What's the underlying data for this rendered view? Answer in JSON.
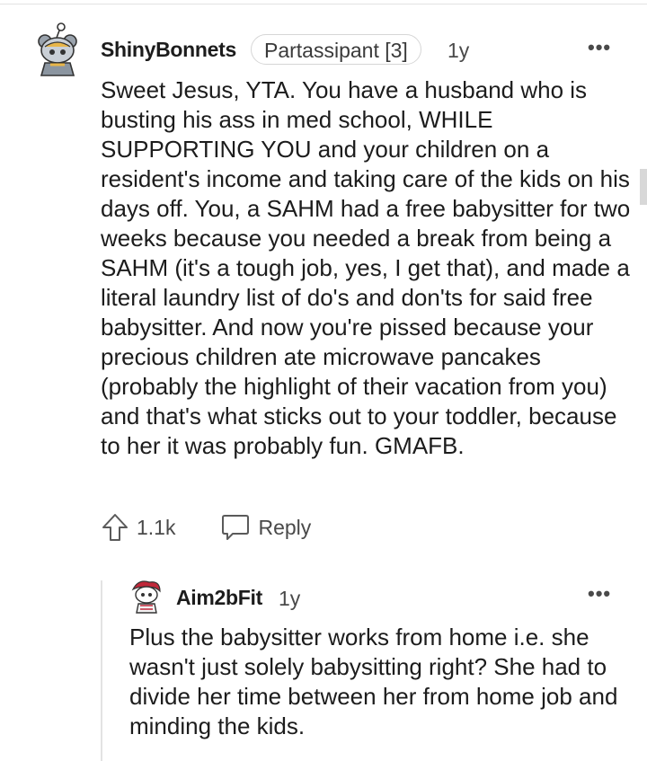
{
  "comment": {
    "username": "ShinyBonnets",
    "flair": "Partassipant [3]",
    "age": "1y",
    "more_label": "•••",
    "body": "Sweet Jesus, YTA. You have a husband who is busting his ass in med school, WHILE SUPPORTING YOU and your children on a resident's income and taking care of the kids on his days off. You, a SAHM had a free babysitter for two weeks because you needed a break from being a SAHM (it's a tough job, yes, I get that), and made a literal laundry list of do's and don'ts for said free babysitter. And now you're pissed because your precious children ate microwave pancakes (probably the highlight of their vacation from you) and that's what sticks out to your toddler, because to her it was probably fun. GMAFB.",
    "upvotes": "1.1k",
    "reply_label": "Reply"
  },
  "reply": {
    "username": "Aim2bFit",
    "age": "1y",
    "more_label": "•••",
    "body": "Plus the babysitter works from home i.e. she wasn't just solely babysitting right? She had to divide her time between her from home job and minding the kids."
  }
}
